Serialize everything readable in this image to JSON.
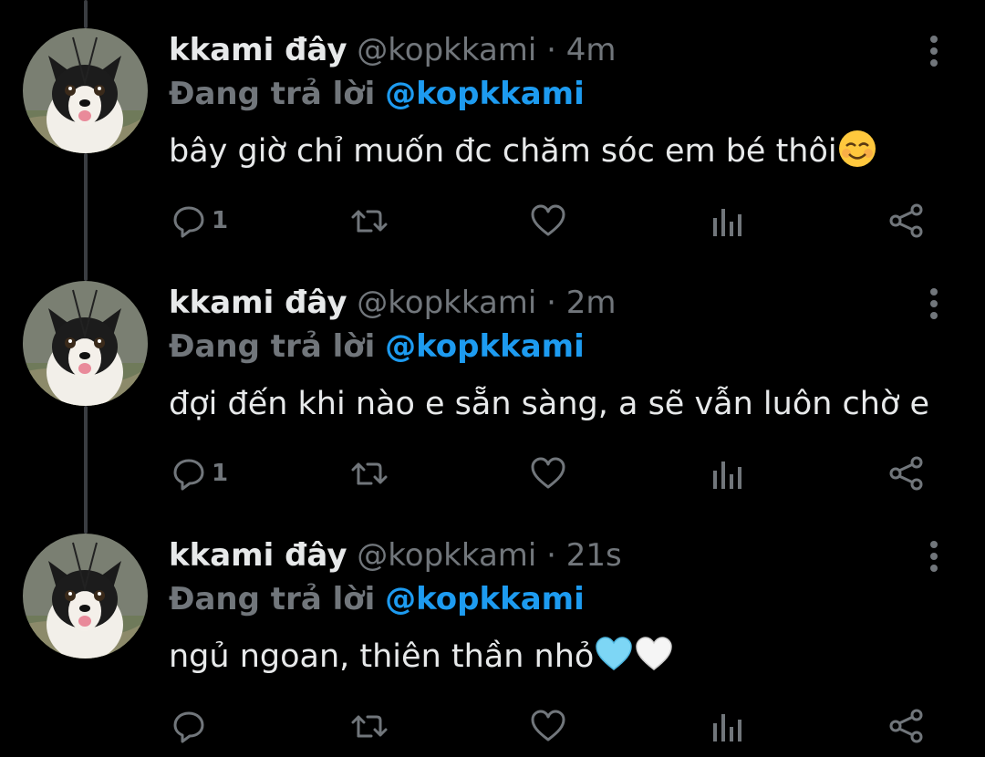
{
  "tweets": [
    {
      "name": "kkami đây",
      "handle": "@kopkkami",
      "separator": "·",
      "time": "4m",
      "reply_prefix": "Đang trả lời",
      "reply_mention": "@kopkkami",
      "text": "bây giờ chỉ muốn đc chăm sóc em bé thôi",
      "emojis": [
        "smiling-face-icon"
      ],
      "reply_count": "1"
    },
    {
      "name": "kkami đây",
      "handle": "@kopkkami",
      "separator": "·",
      "time": "2m",
      "reply_prefix": "Đang trả lời",
      "reply_mention": "@kopkkami",
      "text": "đợi đến khi nào e sẵn sàng, a sẽ vẫn luôn chờ e",
      "emojis": [],
      "reply_count": "1"
    },
    {
      "name": "kkami đây",
      "handle": "@kopkkami",
      "separator": "·",
      "time": "21s",
      "reply_prefix": "Đang trả lời",
      "reply_mention": "@kopkkami",
      "text": "ngủ ngoan, thiên thần nhỏ",
      "emojis": [
        "light-blue-heart-icon",
        "white-heart-icon"
      ],
      "reply_count": ""
    }
  ],
  "icons": {
    "reply": "reply-icon",
    "retweet": "retweet-icon",
    "like": "heart-icon",
    "views": "analytics-icon",
    "share": "share-icon",
    "more": "more-options-icon"
  },
  "colors": {
    "background": "#000000",
    "primary_text": "#e7e9ea",
    "secondary_text": "#71767b",
    "mention": "#1d9bf0",
    "thread_line": "#3a3d41"
  }
}
